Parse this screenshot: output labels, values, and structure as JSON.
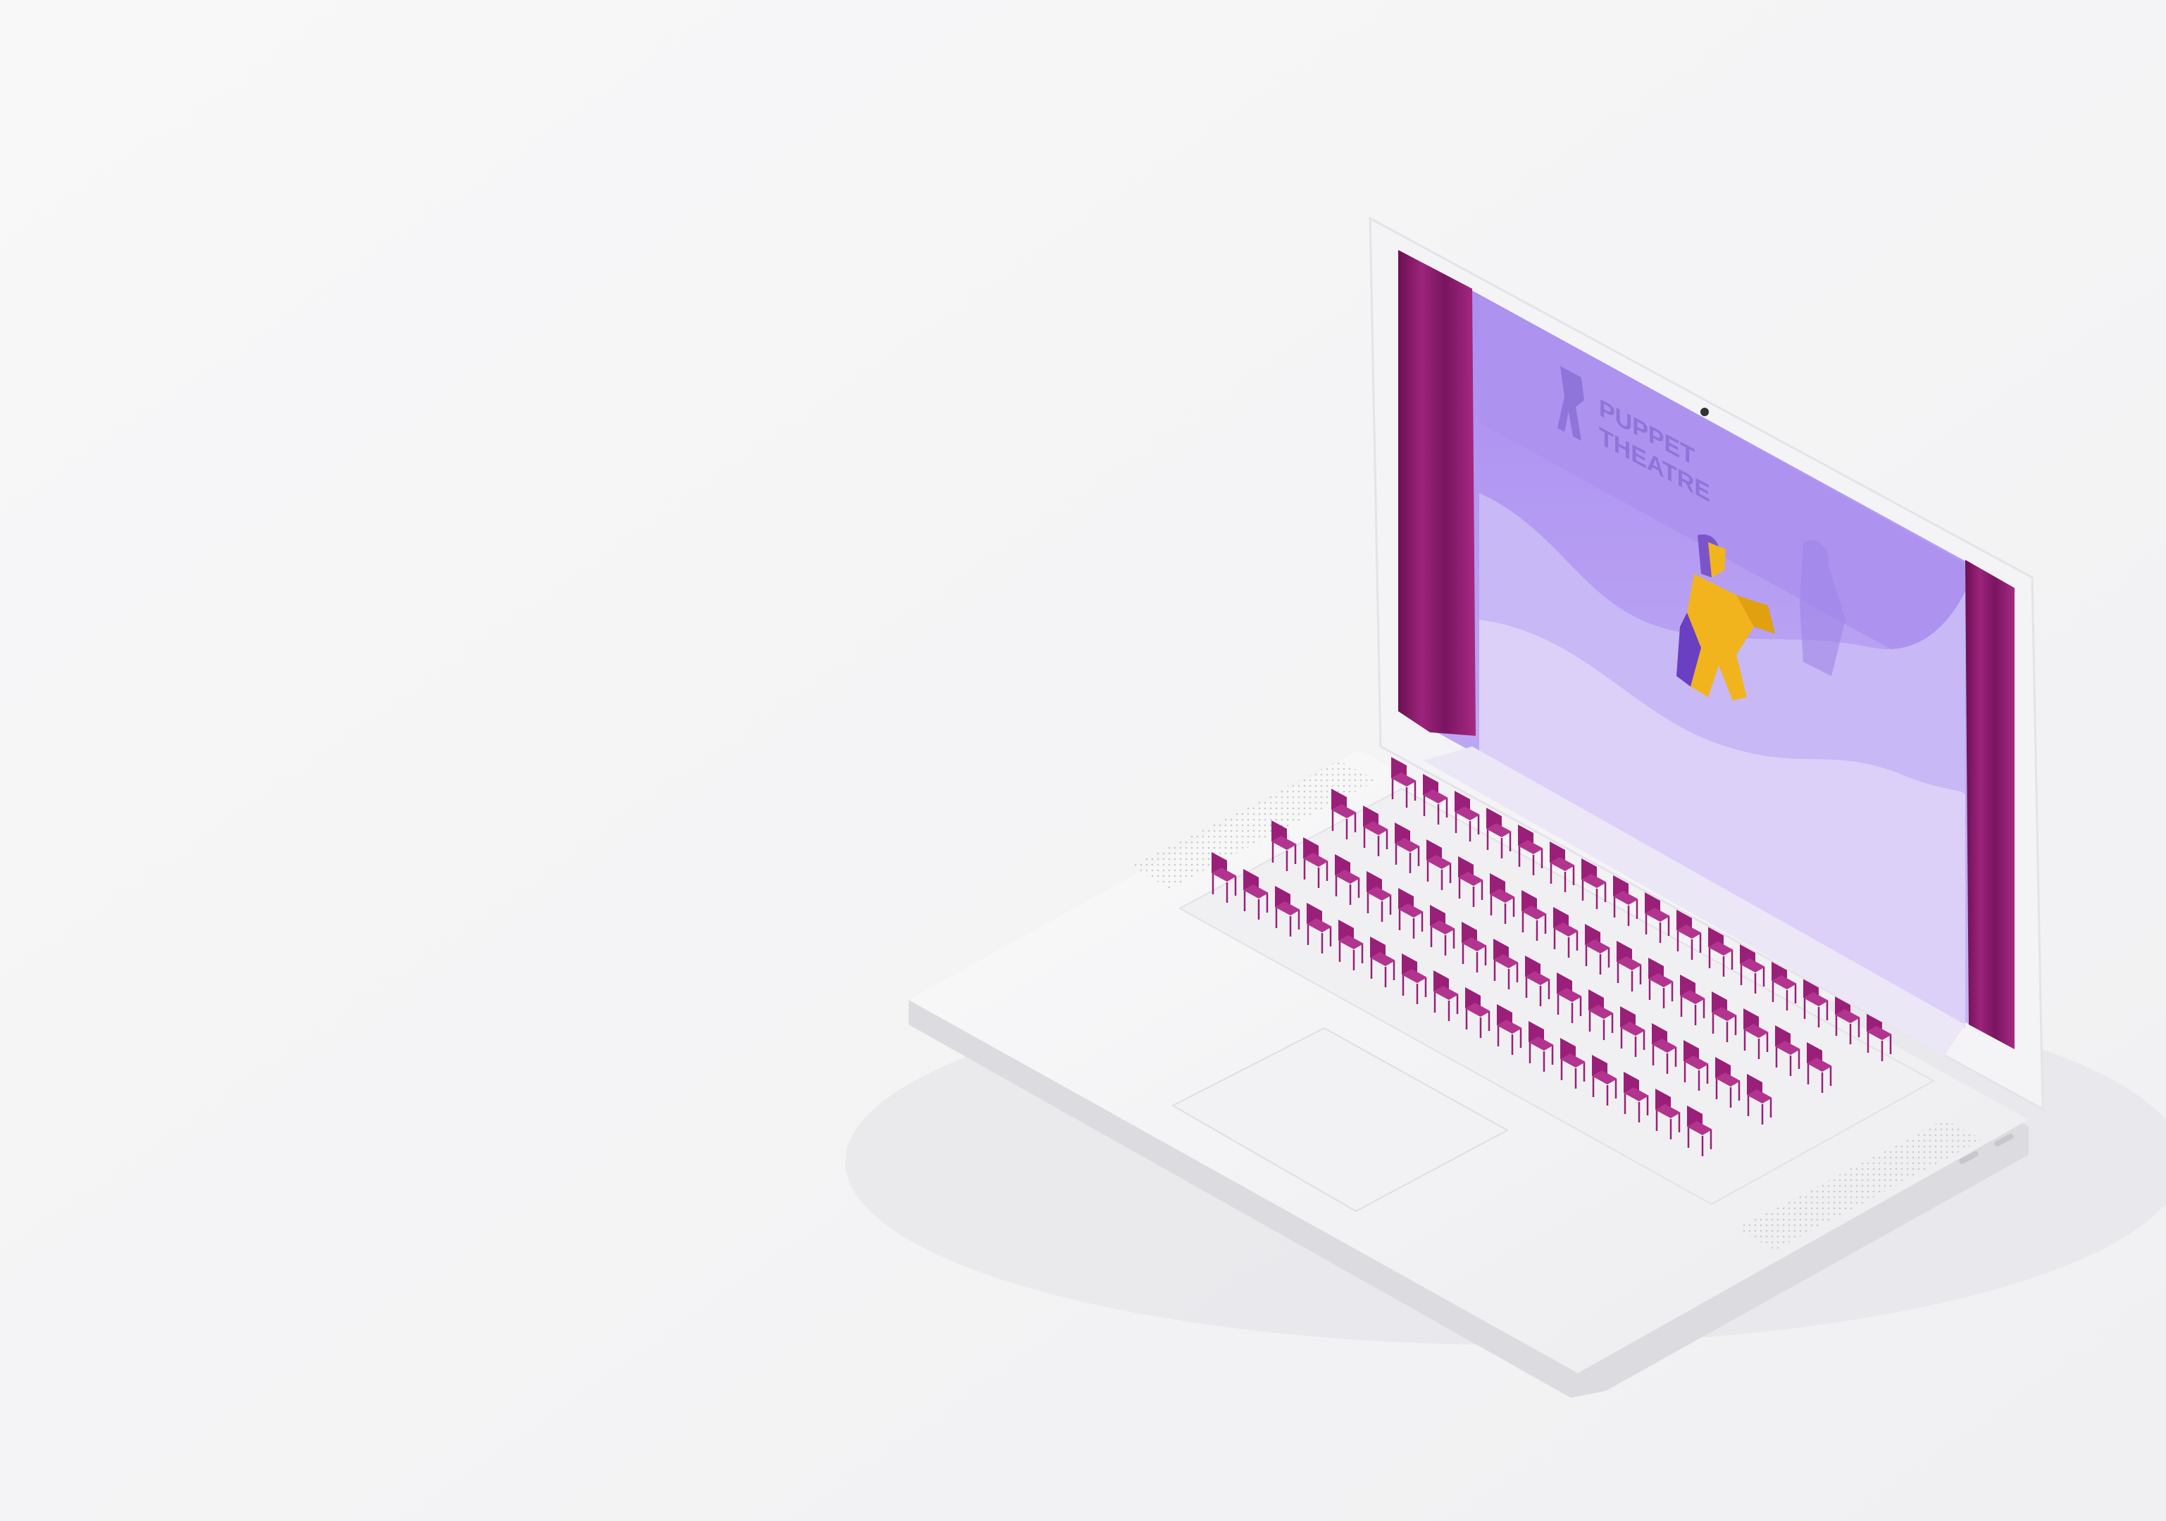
{
  "scene": {
    "description_tags": [
      "laptop",
      "puppet-theatre-illustration",
      "audience-seats"
    ]
  },
  "screen": {
    "logo": {
      "line1": "PUPPET",
      "line2": "THEATRE"
    }
  },
  "colors": {
    "background": "#f6f6f7",
    "laptop_body": "#f3f3f5",
    "stage_purple": "#b9a4f2",
    "stage_light": "#d8cdf7",
    "curtain": "#8a1a6b",
    "seat": "#9a1f78",
    "puppet_yellow": "#f2b41c"
  },
  "icons": {
    "puppet": "puppet-figure-icon",
    "logo": "theatre-logo-icon",
    "camera": "webcam-icon"
  }
}
